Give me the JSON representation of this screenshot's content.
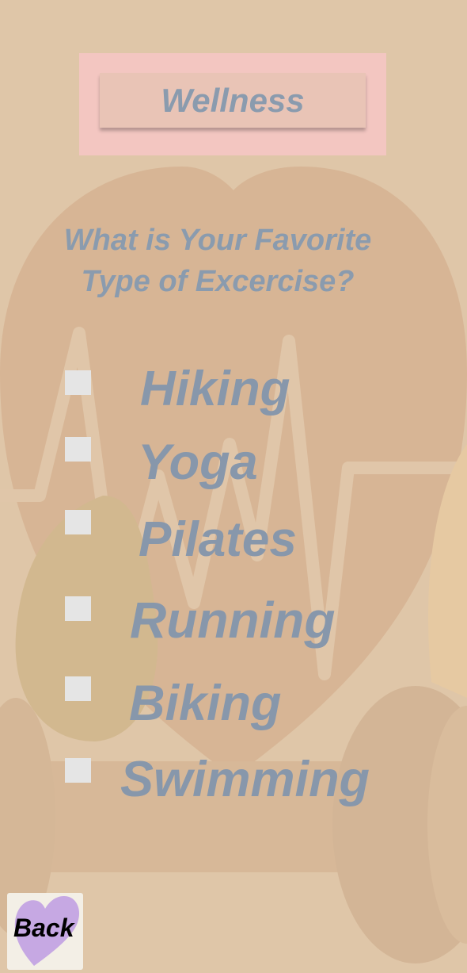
{
  "header": {
    "title": "Wellness"
  },
  "question": {
    "line1": "What is Your Favorite",
    "line2": "Type of Excercise?"
  },
  "options": [
    {
      "label": "Hiking",
      "checked": false
    },
    {
      "label": "Yoga",
      "checked": false
    },
    {
      "label": "Pilates",
      "checked": false
    },
    {
      "label": "Running",
      "checked": false
    },
    {
      "label": "Biking",
      "checked": false
    },
    {
      "label": "Swimming",
      "checked": false
    }
  ],
  "back": {
    "label": "Back"
  },
  "colors": {
    "background": "#dfc6a8",
    "text_accent": "#8a9bae",
    "header_frame": "#f3c6c1",
    "back_heart": "#c6a8e3"
  }
}
